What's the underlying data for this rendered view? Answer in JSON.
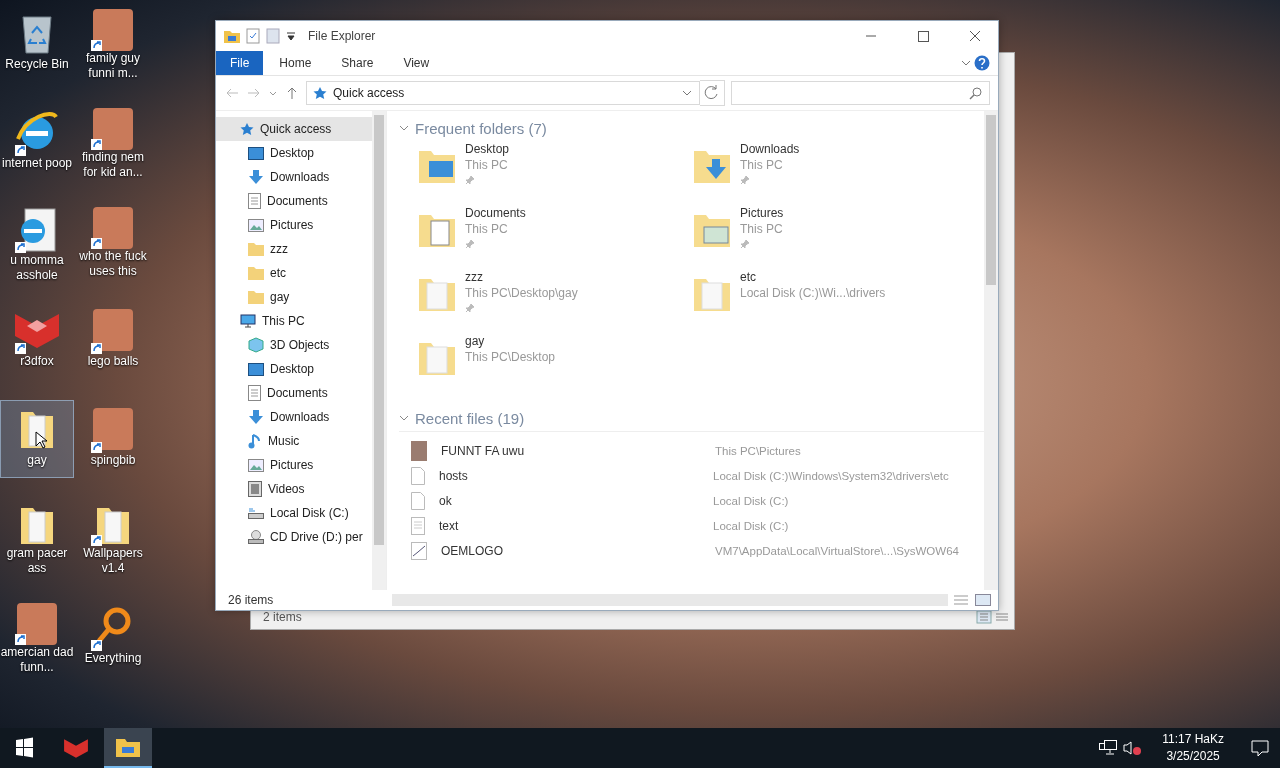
{
  "desktop_icons": [
    {
      "label": "Recycle Bin",
      "kind": "recycle",
      "shortcut": false,
      "selected": false
    },
    {
      "label": "family guy funni m...",
      "kind": "picture",
      "shortcut": true,
      "selected": false
    },
    {
      "label": "internet poop",
      "kind": "browser",
      "shortcut": true,
      "selected": false
    },
    {
      "label": "finding nem for kid an...",
      "kind": "picture",
      "shortcut": true,
      "selected": false
    },
    {
      "label": "u momma asshole",
      "kind": "webpage",
      "shortcut": true,
      "selected": false
    },
    {
      "label": "who the fuck uses this",
      "kind": "picture",
      "shortcut": true,
      "selected": false
    },
    {
      "label": "r3dfox",
      "kind": "app",
      "shortcut": true,
      "selected": false
    },
    {
      "label": "lego balls",
      "kind": "picture",
      "shortcut": true,
      "selected": false
    },
    {
      "label": "gay",
      "kind": "folder",
      "shortcut": false,
      "selected": true
    },
    {
      "label": "spingbib",
      "kind": "picture",
      "shortcut": true,
      "selected": false
    },
    {
      "label": "gram pacer ass",
      "kind": "folder",
      "shortcut": false,
      "selected": false
    },
    {
      "label": "Wallpapers v1.4",
      "kind": "folder",
      "shortcut": true,
      "selected": false
    },
    {
      "label": "amercian dad funn...",
      "kind": "picture",
      "shortcut": true,
      "selected": false
    },
    {
      "label": "Everything",
      "kind": "search",
      "shortcut": true,
      "selected": false
    }
  ],
  "back_window": {
    "status": "2 items"
  },
  "explorer": {
    "title": "File Explorer",
    "ribbon_tabs": [
      {
        "label": "File",
        "selected": true
      },
      {
        "label": "Home",
        "selected": false
      },
      {
        "label": "Share",
        "selected": false
      },
      {
        "label": "View",
        "selected": false
      }
    ],
    "address": "Quick access",
    "nav": [
      {
        "label": "Quick access",
        "kind": "star",
        "selected": true,
        "children": [
          {
            "label": "Desktop",
            "kind": "desktop",
            "selected": false
          },
          {
            "label": "Downloads",
            "kind": "downloads",
            "selected": false
          },
          {
            "label": "Documents",
            "kind": "documents",
            "selected": false
          },
          {
            "label": "Pictures",
            "kind": "pictures",
            "selected": false
          },
          {
            "label": "zzz",
            "kind": "folder",
            "selected": false
          },
          {
            "label": "etc",
            "kind": "folder",
            "selected": false
          },
          {
            "label": "gay",
            "kind": "folder",
            "selected": false
          }
        ]
      },
      {
        "label": "This PC",
        "kind": "pc",
        "selected": false,
        "children": [
          {
            "label": "3D Objects",
            "kind": "objects",
            "selected": false
          },
          {
            "label": "Desktop",
            "kind": "desktop",
            "selected": false
          },
          {
            "label": "Documents",
            "kind": "documents",
            "selected": false
          },
          {
            "label": "Downloads",
            "kind": "downloads",
            "selected": false
          },
          {
            "label": "Music",
            "kind": "music",
            "selected": false
          },
          {
            "label": "Pictures",
            "kind": "pictures",
            "selected": false
          },
          {
            "label": "Videos",
            "kind": "videos",
            "selected": false
          },
          {
            "label": "Local Disk (C:)",
            "kind": "disk",
            "selected": false
          },
          {
            "label": "CD Drive (D:) per",
            "kind": "cd",
            "selected": false
          }
        ]
      }
    ],
    "frequent": {
      "title": "Frequent folders (7)",
      "expanded": true,
      "items": [
        {
          "name": "Desktop",
          "location": "This PC",
          "kind": "desktop",
          "pinned": true
        },
        {
          "name": "Downloads",
          "location": "This PC",
          "kind": "downloads",
          "pinned": true
        },
        {
          "name": "Documents",
          "location": "This PC",
          "kind": "documents",
          "pinned": true
        },
        {
          "name": "Pictures",
          "location": "This PC",
          "kind": "pictures",
          "pinned": true
        },
        {
          "name": "zzz",
          "location": "This PC\\Desktop\\gay",
          "kind": "folder",
          "pinned": true
        },
        {
          "name": "etc",
          "location": "Local Disk (C:)\\Wi...\\drivers",
          "kind": "folder",
          "pinned": false
        },
        {
          "name": "gay",
          "location": "This PC\\Desktop",
          "kind": "folder",
          "pinned": false
        }
      ]
    },
    "recent": {
      "title": "Recent files (19)",
      "expanded": true,
      "items": [
        {
          "name": "FUNNT FA uwu",
          "location": "This PC\\Pictures",
          "kind": "image"
        },
        {
          "name": "hosts",
          "location": "Local Disk (C:)\\Windows\\System32\\drivers\\etc",
          "kind": "file"
        },
        {
          "name": "ok",
          "location": "Local Disk (C:)",
          "kind": "file"
        },
        {
          "name": "text",
          "location": "Local Disk (C:)",
          "kind": "text"
        },
        {
          "name": "OEMLOGO",
          "location": "VM7\\AppData\\Local\\VirtualStore\\...\\SysWOW64",
          "kind": "bitmap"
        }
      ]
    },
    "status": "26 items"
  },
  "taskbar": {
    "apps": [
      {
        "kind": "app",
        "selected": false
      },
      {
        "kind": "explorer",
        "selected": true
      }
    ],
    "time": "11:17 HaKz",
    "date": "3/25/2025",
    "muted": true
  }
}
